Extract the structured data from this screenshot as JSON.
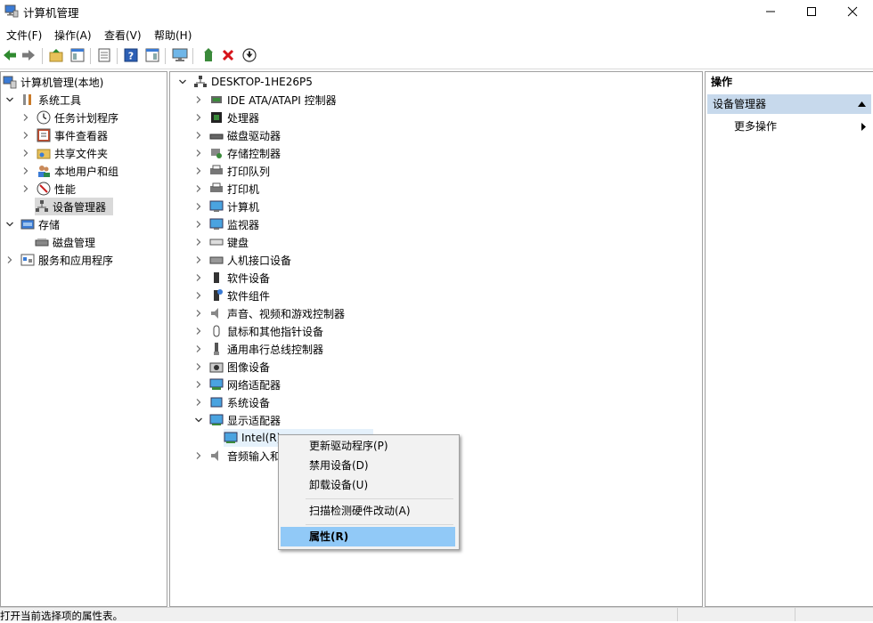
{
  "window": {
    "title": "计算机管理"
  },
  "menu": [
    "文件(F)",
    "操作(A)",
    "查看(V)",
    "帮助(H)"
  ],
  "tree_left": {
    "root": "计算机管理(本地)",
    "items": [
      {
        "label": "系统工具"
      },
      {
        "label": "任务计划程序"
      },
      {
        "label": "事件查看器"
      },
      {
        "label": "共享文件夹"
      },
      {
        "label": "本地用户和组"
      },
      {
        "label": "性能"
      },
      {
        "label": "设备管理器"
      },
      {
        "label": "存储"
      },
      {
        "label": "磁盘管理"
      },
      {
        "label": "服务和应用程序"
      }
    ]
  },
  "device_tree": {
    "root": "DESKTOP-1HE26P5",
    "categories": [
      "IDE ATA/ATAPI 控制器",
      "处理器",
      "磁盘驱动器",
      "存储控制器",
      "打印队列",
      "打印机",
      "计算机",
      "监视器",
      "键盘",
      "人机接口设备",
      "软件设备",
      "软件组件",
      "声音、视频和游戏控制器",
      "鼠标和其他指针设备",
      "通用串行总线控制器",
      "图像设备",
      "网络适配器",
      "系统设备",
      "显示适配器"
    ],
    "child_device": "Intel(R)",
    "partial_last": "音频输入和"
  },
  "actions_panel": {
    "title": "操作",
    "section": "设备管理器",
    "more": "更多操作"
  },
  "context_menu": {
    "items": [
      "更新驱动程序(P)",
      "禁用设备(D)",
      "卸载设备(U)",
      "扫描检测硬件改动(A)",
      "属性(R)"
    ]
  },
  "status": {
    "text": "打开当前选择项的属性表。"
  },
  "colors": {
    "selection": "#91c9f7",
    "band": "#c7d9ec",
    "tree_selected": "#d9d9d9"
  }
}
